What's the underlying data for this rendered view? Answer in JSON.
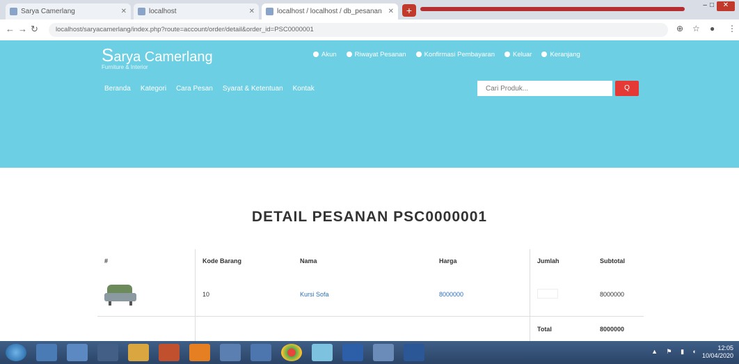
{
  "browser": {
    "tabs": [
      {
        "label": "Sarya Camerlang"
      },
      {
        "label": "localhost"
      },
      {
        "label": "localhost / localhost / db_pesanan"
      }
    ],
    "url": "localhost/saryacamerlang/index.php?route=account/order/detail&order_id=PSC0000001",
    "new_tab": "+"
  },
  "site": {
    "brand_initial": "S",
    "brand_rest": "arya Camerlang",
    "tagline": "Furniture & Interior",
    "top_links": [
      "Akun",
      "Riwayat Pesanan",
      "Konfirmasi Pembayaran",
      "Keluar",
      "Keranjang"
    ],
    "nav": [
      "Beranda",
      "Kategori",
      "Cara Pesan",
      "Syarat & Ketentuan",
      "Kontak"
    ],
    "search_placeholder": "Cari Produk...",
    "search_button": "Q"
  },
  "main": {
    "title": "DETAIL PESANAN PSC0000001",
    "table": {
      "headers": [
        "#",
        "Kode Barang",
        "Nama",
        "Harga",
        "Jumlah",
        "Subtotal"
      ],
      "rows": [
        {
          "code": "10",
          "name": "Kursi Sofa",
          "price": "8000000",
          "qty": "",
          "subtotal": "8000000"
        }
      ],
      "total_label": "Total",
      "total_value": "8000000"
    }
  },
  "taskbar": {
    "clock_time": "12:05",
    "clock_date": "10/04/2020"
  }
}
